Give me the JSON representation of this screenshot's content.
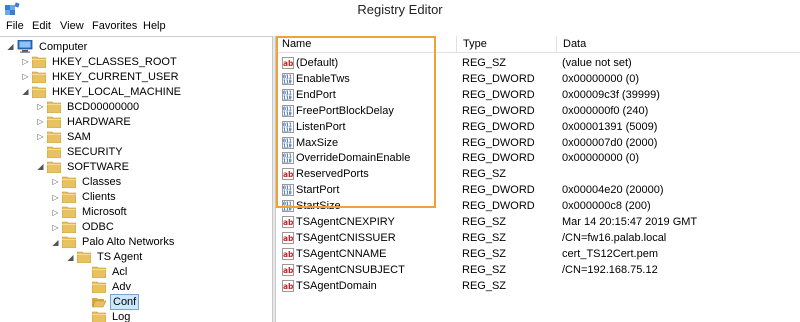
{
  "window": {
    "title": "Registry Editor"
  },
  "menu": [
    "File",
    "Edit",
    "View",
    "Favorites",
    "Help"
  ],
  "tree": [
    {
      "label": "Computer",
      "level": 0,
      "expander": "open",
      "icon": "computer-icon"
    },
    {
      "label": "HKEY_CLASSES_ROOT",
      "level": 1,
      "expander": "closed",
      "icon": "folder-icon"
    },
    {
      "label": "HKEY_CURRENT_USER",
      "level": 1,
      "expander": "closed",
      "icon": "folder-icon"
    },
    {
      "label": "HKEY_LOCAL_MACHINE",
      "level": 1,
      "expander": "open",
      "icon": "folder-icon"
    },
    {
      "label": "BCD00000000",
      "level": 2,
      "expander": "closed",
      "icon": "folder-icon"
    },
    {
      "label": "HARDWARE",
      "level": 2,
      "expander": "closed",
      "icon": "folder-icon"
    },
    {
      "label": "SAM",
      "level": 2,
      "expander": "closed",
      "icon": "folder-icon"
    },
    {
      "label": "SECURITY",
      "level": 2,
      "expander": "none",
      "icon": "folder-icon"
    },
    {
      "label": "SOFTWARE",
      "level": 2,
      "expander": "open",
      "icon": "folder-icon"
    },
    {
      "label": "Classes",
      "level": 3,
      "expander": "closed",
      "icon": "folder-icon"
    },
    {
      "label": "Clients",
      "level": 3,
      "expander": "closed",
      "icon": "folder-icon"
    },
    {
      "label": "Microsoft",
      "level": 3,
      "expander": "closed",
      "icon": "folder-icon"
    },
    {
      "label": "ODBC",
      "level": 3,
      "expander": "closed",
      "icon": "folder-icon"
    },
    {
      "label": "Palo Alto Networks",
      "level": 3,
      "expander": "open",
      "icon": "folder-icon"
    },
    {
      "label": "TS Agent",
      "level": 4,
      "expander": "open",
      "icon": "folder-icon"
    },
    {
      "label": "Acl",
      "level": 5,
      "expander": "none",
      "icon": "folder-icon"
    },
    {
      "label": "Adv",
      "level": 5,
      "expander": "none",
      "icon": "folder-icon"
    },
    {
      "label": "Conf",
      "level": 5,
      "expander": "none",
      "icon": "folder-open-icon",
      "selected": true
    },
    {
      "label": "Log",
      "level": 5,
      "expander": "none",
      "icon": "folder-icon"
    }
  ],
  "columns": {
    "name": "Name",
    "type": "Type",
    "data": "Data"
  },
  "values": [
    {
      "name": "(Default)",
      "type": "REG_SZ",
      "data": "(value not set)",
      "icon": "string-value-icon"
    },
    {
      "name": "EnableTws",
      "type": "REG_DWORD",
      "data": "0x00000000 (0)",
      "icon": "binary-value-icon"
    },
    {
      "name": "EndPort",
      "type": "REG_DWORD",
      "data": "0x00009c3f (39999)",
      "icon": "binary-value-icon"
    },
    {
      "name": "FreePortBlockDelay",
      "type": "REG_DWORD",
      "data": "0x000000f0 (240)",
      "icon": "binary-value-icon"
    },
    {
      "name": "ListenPort",
      "type": "REG_DWORD",
      "data": "0x00001391 (5009)",
      "icon": "binary-value-icon"
    },
    {
      "name": "MaxSize",
      "type": "REG_DWORD",
      "data": "0x000007d0 (2000)",
      "icon": "binary-value-icon"
    },
    {
      "name": "OverrideDomainEnable",
      "type": "REG_DWORD",
      "data": "0x00000000 (0)",
      "icon": "binary-value-icon"
    },
    {
      "name": "ReservedPorts",
      "type": "REG_SZ",
      "data": "",
      "icon": "string-value-icon"
    },
    {
      "name": "StartPort",
      "type": "REG_DWORD",
      "data": "0x00004e20 (20000)",
      "icon": "binary-value-icon"
    },
    {
      "name": "StartSize",
      "type": "REG_DWORD",
      "data": "0x000000c8 (200)",
      "icon": "binary-value-icon"
    },
    {
      "name": "TSAgentCNEXPIRY",
      "type": "REG_SZ",
      "data": "Mar 14 20:15:47 2019 GMT",
      "icon": "string-value-icon"
    },
    {
      "name": "TSAgentCNISSUER",
      "type": "REG_SZ",
      "data": "/CN=fw16.palab.local",
      "icon": "string-value-icon"
    },
    {
      "name": "TSAgentCNNAME",
      "type": "REG_SZ",
      "data": "cert_TS12Cert.pem",
      "icon": "string-value-icon"
    },
    {
      "name": "TSAgentCNSUBJECT",
      "type": "REG_SZ",
      "data": "/CN=192.168.75.12",
      "icon": "string-value-icon"
    },
    {
      "name": "TSAgentDomain",
      "type": "REG_SZ",
      "data": "",
      "icon": "string-value-icon"
    }
  ],
  "colors": {
    "highlight_box": "#f0a238",
    "selection": "#cce8ff",
    "folder": "#e8c261"
  }
}
